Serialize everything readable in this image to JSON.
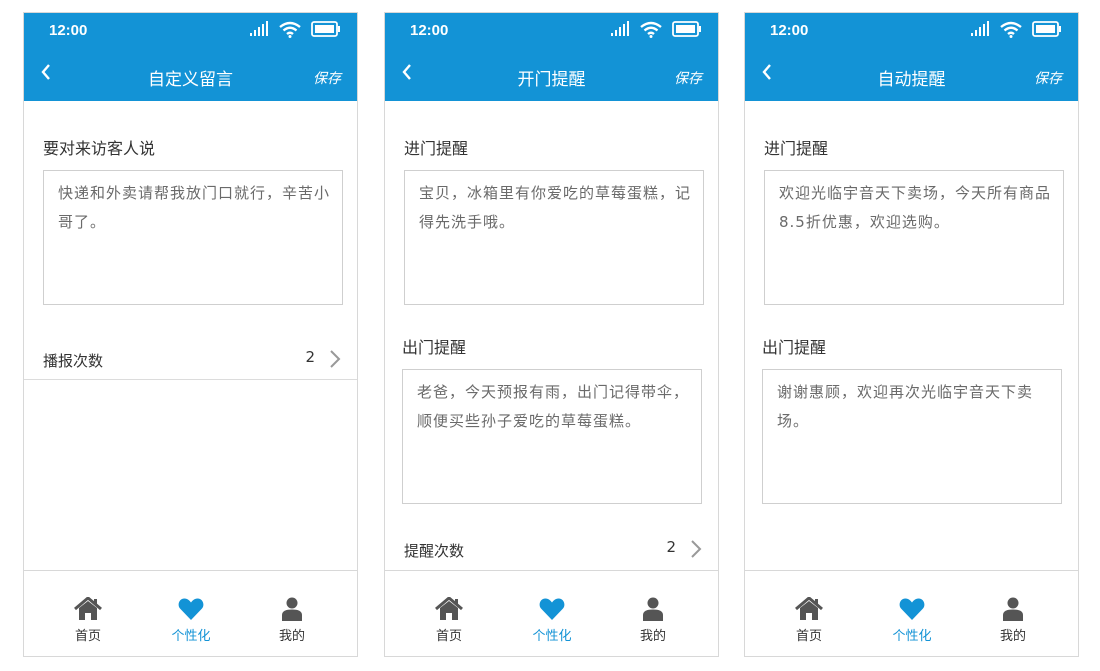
{
  "screens": [
    {
      "status_time": "12:00",
      "title": "自定义留言",
      "save_label": "保存",
      "section1_label": "要对来访客人说",
      "section1_text": "快递和外卖请帮我放门口就行，辛苦小哥了。",
      "count_label": "播报次数",
      "count_value": "2"
    },
    {
      "status_time": "12:00",
      "title": "开门提醒",
      "save_label": "保存",
      "section1_label": "进门提醒",
      "section1_text": "宝贝，冰箱里有你爱吃的草莓蛋糕，记得先洗手哦。",
      "section2_label": "出门提醒",
      "section2_text": "老爸，今天预报有雨，出门记得带伞，顺便买些孙子爱吃的草莓蛋糕。",
      "count_label": "提醒次数",
      "count_value": "2"
    },
    {
      "status_time": "12:00",
      "title": "自动提醒",
      "save_label": "保存",
      "section1_label": "进门提醒",
      "section1_text": "欢迎光临宇音天下卖场，今天所有商品8.5折优惠，欢迎选购。",
      "section2_label": "出门提醒",
      "section2_text": "谢谢惠顾，欢迎再次光临宇音天下卖场。"
    }
  ],
  "tabbar": {
    "home": "首页",
    "personalize": "个性化",
    "mine": "我的"
  },
  "icons": {
    "back": "chevron-left-icon",
    "signal": "signal-icon",
    "wifi": "wifi-icon",
    "battery": "battery-icon",
    "chevron": "chevron-right-icon",
    "home": "home-icon",
    "heart": "heart-icon",
    "person": "person-icon"
  },
  "colors": {
    "brand": "#1393d6",
    "icon_gray": "#555555",
    "border": "#cfcfcf"
  }
}
